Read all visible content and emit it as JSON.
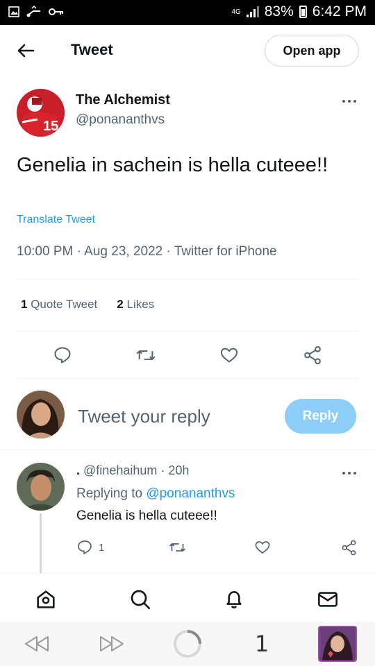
{
  "status_bar": {
    "network": "4G",
    "battery": "83%",
    "time": "6:42 PM"
  },
  "header": {
    "title": "Tweet",
    "open_app_label": "Open app"
  },
  "tweet": {
    "author_name": "The Alchemist",
    "author_handle": "@ponananthvs",
    "text": "Genelia in sachein is hella cuteee!!",
    "translate_label": "Translate Tweet",
    "meta": "10:00 PM · Aug 23, 2022 · Twitter for iPhone",
    "quote_count": "1",
    "quote_label": "Quote Tweet",
    "likes_count": "2",
    "likes_label": "Likes"
  },
  "composer": {
    "placeholder": "Tweet your reply",
    "reply_label": "Reply"
  },
  "reply": {
    "name": ".",
    "handle_time": "@finehaihum · 20h",
    "replying_prefix": "Replying to",
    "replying_to": "@ponananthvs",
    "text": "Genelia is hella cuteee!!",
    "reply_count": "1"
  },
  "browser": {
    "tab_count": "1"
  },
  "colors": {
    "accent": "#1d9bf0",
    "reply_button": "#8ecdf8",
    "secondary_text": "#536471"
  }
}
